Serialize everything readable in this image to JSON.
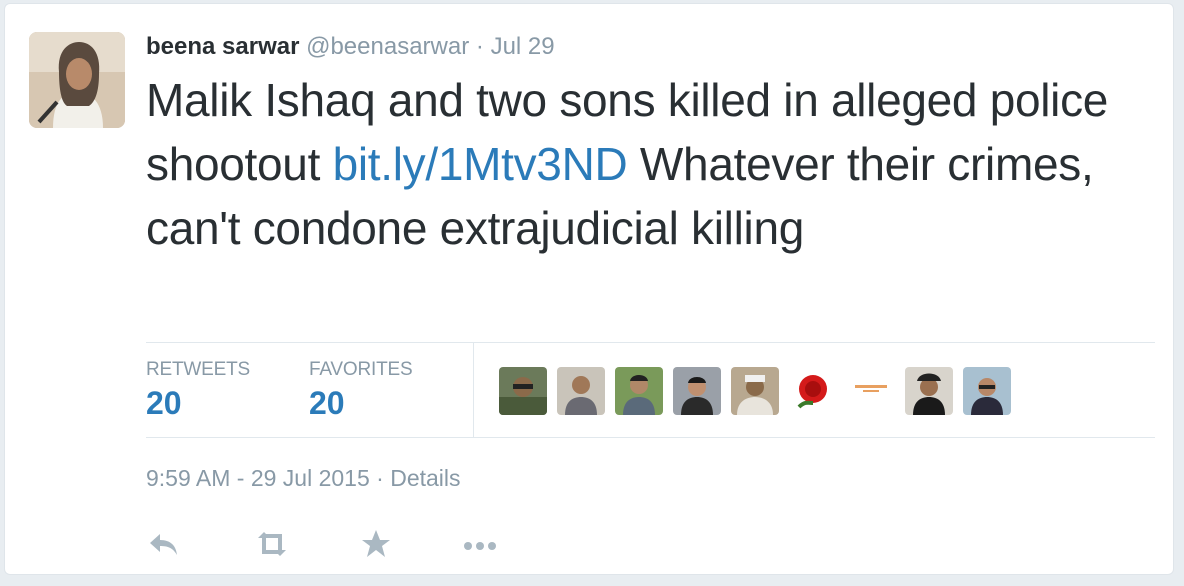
{
  "tweet": {
    "author_name": "beena sarwar",
    "handle": "@beenasarwar",
    "separator": "·",
    "date": "Jul 29",
    "text_before_link": "Malik Ishaq and two sons killed in alleged police shootout ",
    "link": "bit.ly/1Mtv3ND",
    "text_after_link": " Whatever their crimes, can't condone extrajudicial killing"
  },
  "stats": {
    "retweets_label": "RETWEETS",
    "retweets_count": "20",
    "favorites_label": "FAVORITES",
    "favorites_count": "20"
  },
  "favoriters": [
    {
      "icon": "user-avatar-1"
    },
    {
      "icon": "user-avatar-2"
    },
    {
      "icon": "user-avatar-3"
    },
    {
      "icon": "user-avatar-4"
    },
    {
      "icon": "user-avatar-5"
    },
    {
      "icon": "rose-avatar"
    },
    {
      "icon": "text-logo-avatar"
    },
    {
      "icon": "user-avatar-8"
    },
    {
      "icon": "user-avatar-9"
    }
  ],
  "meta": {
    "timestamp": "9:59 AM - 29 Jul 2015",
    "separator": "·",
    "details_link": "Details"
  },
  "actions": [
    {
      "icon": "reply-icon"
    },
    {
      "icon": "retweet-icon"
    },
    {
      "icon": "favorite-star-icon"
    },
    {
      "icon": "more-icon"
    }
  ],
  "colors": {
    "link": "#2b7bb9",
    "text": "#292f33",
    "muted": "#8899a6",
    "border": "#e1e8ed"
  }
}
